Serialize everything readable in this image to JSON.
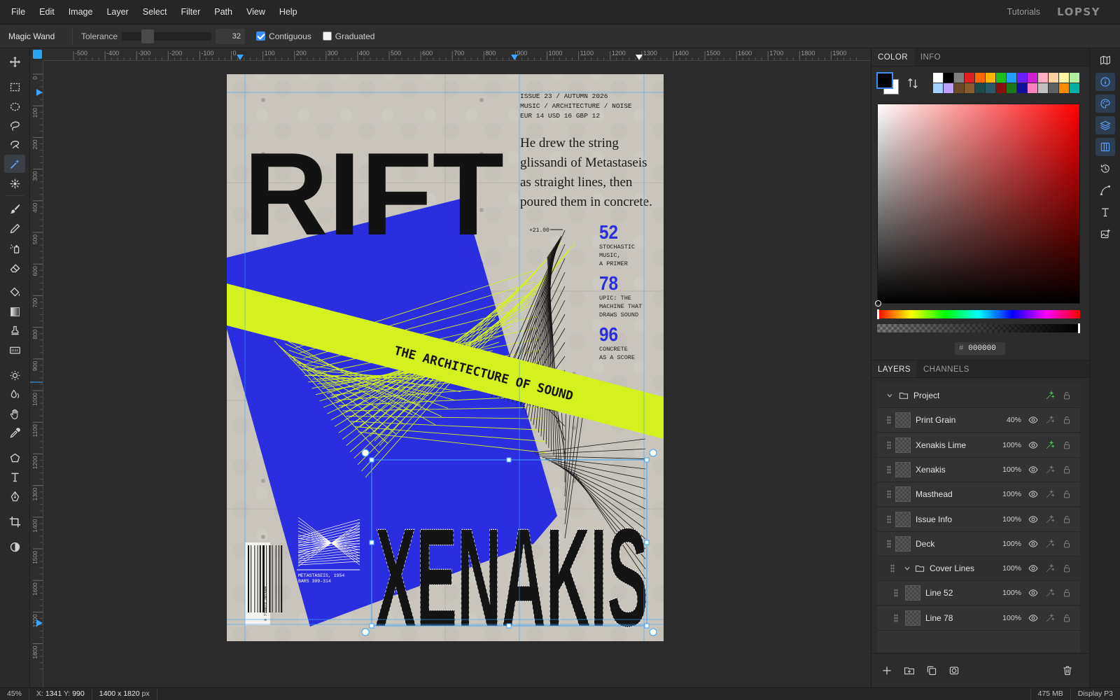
{
  "menu": [
    "File",
    "Edit",
    "Image",
    "Layer",
    "Select",
    "Filter",
    "Path",
    "View",
    "Help"
  ],
  "menu_right": {
    "tutorials": "Tutorials",
    "logo": "LOPSY"
  },
  "options": {
    "tool_name": "Magic Wand",
    "tolerance_label": "Tolerance",
    "tolerance_value": "32",
    "tolerance_fraction": 0.25,
    "contiguous_label": "Contiguous",
    "contiguous": true,
    "graduated_label": "Graduated",
    "graduated": false
  },
  "ruler_h": [
    "-500",
    "-400",
    "-300",
    "-200",
    "-100",
    "0",
    "100",
    "200",
    "300",
    "400",
    "500",
    "600",
    "700",
    "800",
    "900",
    "1000",
    "1100",
    "1200",
    "1300",
    "1400",
    "1500",
    "1600",
    "1700",
    "1800",
    "1900"
  ],
  "ruler_v": [
    "0",
    "100",
    "200",
    "300",
    "400",
    "500",
    "600",
    "700",
    "800",
    "900",
    "1000",
    "1100",
    "1200",
    "1300",
    "1400",
    "1500",
    "1600",
    "1700",
    "1800"
  ],
  "poster": {
    "masthead": "RIFT",
    "issue_info": [
      "ISSUE 23 / AUTUMN 2026",
      "MUSIC / ARCHITECTURE / NOISE",
      "EUR 14  USD 16  GBP 12"
    ],
    "deck": [
      "He drew the string",
      "glissandi of Metastaseis",
      "as straight lines, then",
      "poured them in concrete."
    ],
    "marker": "+21.00",
    "cover_lines": [
      {
        "num": "52",
        "text": [
          "STOCHASTIC",
          "MUSIC,",
          "A PRIMER"
        ]
      },
      {
        "num": "78",
        "text": [
          "UPIC: THE",
          "MACHINE THAT",
          "DRAWS SOUND"
        ]
      },
      {
        "num": "96",
        "text": [
          "CONCRETE",
          "AS A SCORE"
        ]
      }
    ],
    "band_text": "THE ARCHITECTURE OF SOUND",
    "headline": "XENAKIS",
    "inset_caption": [
      "METASTASEIS, 1954",
      "BARS 309-314"
    ],
    "barcode_text": "9 770923 202609"
  },
  "panel": {
    "color_tabs": [
      "COLOR",
      "INFO"
    ],
    "swatches": [
      "#ffffff",
      "#000000",
      "#7f7f7f",
      "#e02020",
      "#ff6a00",
      "#ffb400",
      "#1fbf1f",
      "#1fa0ff",
      "#6a1fff",
      "#d01fd0",
      "#ffb0c0",
      "#ffd0a0",
      "#fff4a0",
      "#b0f0a0",
      "#a0d0ff",
      "#c0a0ff",
      "#6b4a2a",
      "#8a5a2a",
      "#1f4a4a",
      "#2a5a6a",
      "#8a1010",
      "#1a7a1a",
      "#1010a0",
      "#ff80c0",
      "#c0c0c0",
      "#606060",
      "#ff8a00",
      "#00b0a0"
    ],
    "hex_label": "#",
    "hex": "000000",
    "layer_tabs": [
      "LAYERS",
      "CHANNELS"
    ],
    "layers": [
      {
        "name": "Project",
        "opacity": "",
        "group": true,
        "indent": 0,
        "fx": true
      },
      {
        "name": "Print Grain",
        "opacity": "40%",
        "group": false,
        "indent": 0,
        "fx": false
      },
      {
        "name": "Xenakis Lime",
        "opacity": "100%",
        "group": false,
        "indent": 0,
        "fx": true
      },
      {
        "name": "Xenakis",
        "opacity": "100%",
        "group": false,
        "indent": 0,
        "fx": false
      },
      {
        "name": "Masthead",
        "opacity": "100%",
        "group": false,
        "indent": 0,
        "fx": false
      },
      {
        "name": "Issue Info",
        "opacity": "100%",
        "group": false,
        "indent": 0,
        "fx": false
      },
      {
        "name": "Deck",
        "opacity": "100%",
        "group": false,
        "indent": 0,
        "fx": false
      },
      {
        "name": "Cover Lines",
        "opacity": "100%",
        "group": true,
        "indent": 1,
        "fx": false
      },
      {
        "name": "Line 52",
        "opacity": "100%",
        "group": false,
        "indent": 2,
        "fx": false
      },
      {
        "name": "Line 78",
        "opacity": "100%",
        "group": false,
        "indent": 2,
        "fx": false
      }
    ]
  },
  "status": {
    "zoom": "45%",
    "x_label": "X:",
    "x": "1341",
    "y_label": "Y:",
    "y": "990",
    "doc_size": "1400 x 1820",
    "doc_unit": "px",
    "memory": "475 MB",
    "profile": "Display P3"
  }
}
